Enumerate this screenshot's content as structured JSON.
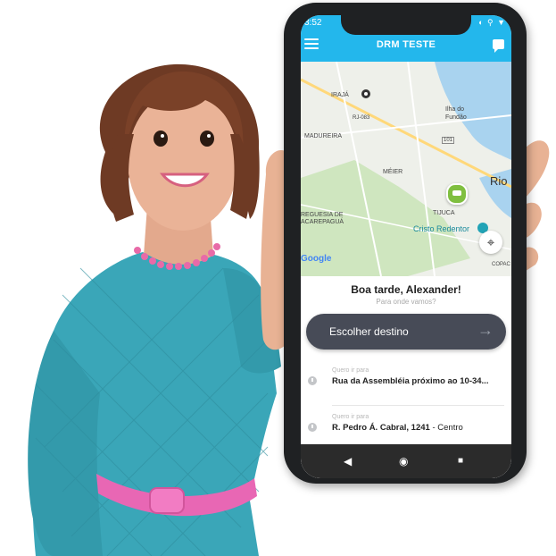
{
  "statusbar": {
    "time": "3:52",
    "icons": "◐ ⚲ ▼"
  },
  "app": {
    "title": "DRM TESTE"
  },
  "map": {
    "labels": {
      "iraja": "IRAJÁ",
      "rj083": "RJ-083",
      "ilha": "Ilha do",
      "fundao": "Fundão",
      "madureira": "MADUREIRA",
      "road101": "101",
      "meier": "MÉIER",
      "rio": "Rio",
      "tijuca": "TIJUCA",
      "freguesia1": "REGUESIA DE",
      "freguesia2": "ACAREPAGUÁ",
      "cristo": "Cristo Redentor",
      "google": "Google",
      "copa": "COPAC"
    }
  },
  "panel": {
    "greeting": "Boa tarde, Alexander!",
    "subtitle": "Para onde vamos?",
    "destination_button": "Escolher destino",
    "recents": [
      {
        "hint": "Quero ir para",
        "address_bold": "Rua da Assembléia próximo ao 10-34...",
        "address_rest": ""
      },
      {
        "hint": "Quero ir para",
        "address_bold": "R. Pedro Á. Cabral, 1241",
        "address_rest": " - Centro"
      }
    ]
  },
  "navbar": {
    "back": "◀",
    "home": "◉",
    "recents": "■"
  },
  "colors": {
    "appbar": "#23b7ec",
    "button": "#474b57",
    "dress": "#3aa6b8",
    "accent_pink": "#e867b4"
  },
  "icons": [
    "menu-icon",
    "chat-icon",
    "locate-icon",
    "car-pin-icon",
    "clock-icon",
    "arrow-right-icon"
  ]
}
